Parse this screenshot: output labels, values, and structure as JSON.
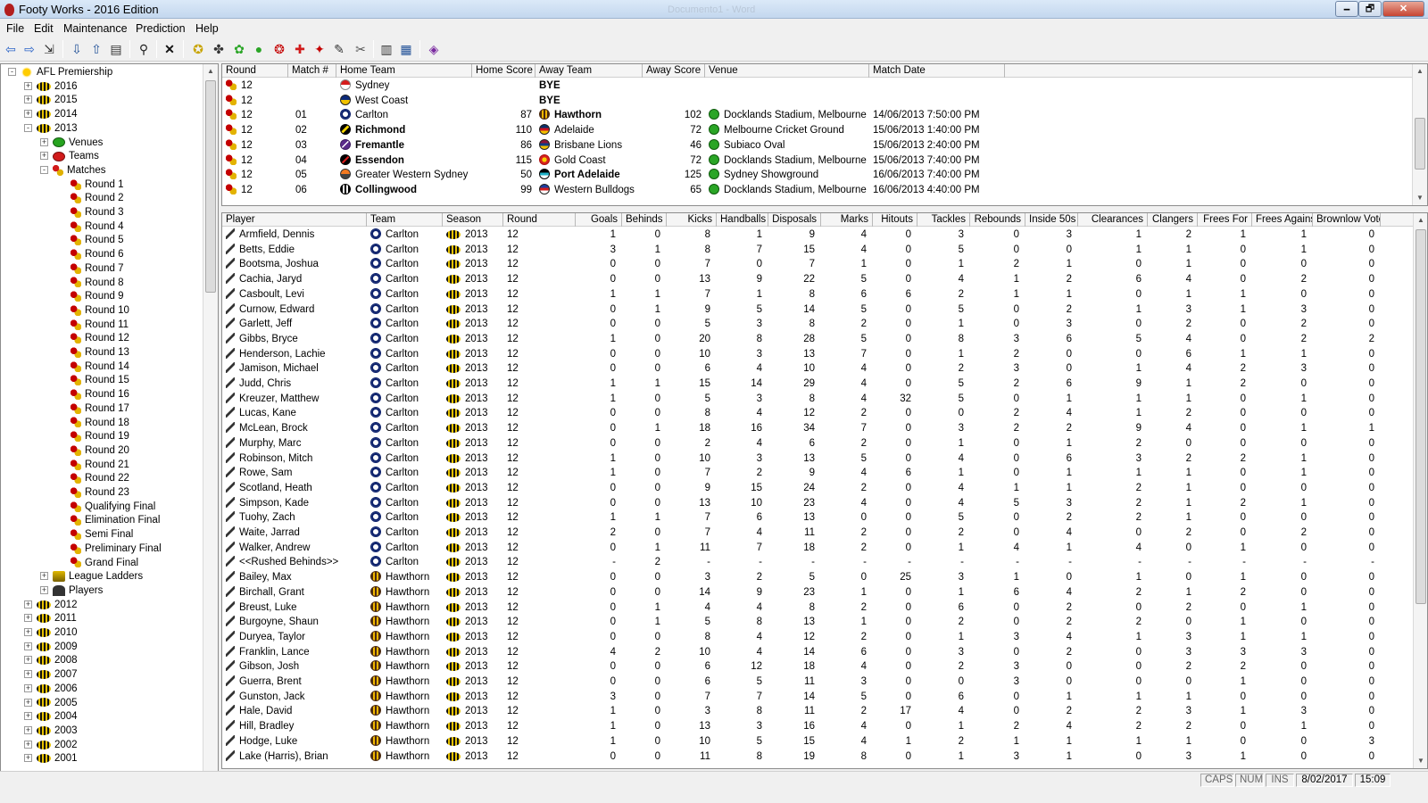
{
  "window": {
    "title": "Footy Works - 2016 Edition",
    "ghost_title": "Documento1 - Word",
    "min_glyph": "🗕",
    "max_glyph": "🗗",
    "close_glyph": "✕"
  },
  "menu": [
    "File",
    "Edit",
    "Maintenance",
    "Prediction",
    "Help"
  ],
  "toolbar_icons": [
    "back-arrow-icon",
    "forward-arrow-icon",
    "go-to-icon",
    "import-icon",
    "export-icon",
    "print-icon",
    "find-icon",
    "delete-icon",
    "add-year-icon",
    "add-round-icon",
    "add-team-icon",
    "add-venue-icon",
    "add-match-icon",
    "add-player-icon",
    "add-stats-icon",
    "add-ladder-icon",
    "tools-icon",
    "book-icon",
    "notes-icon",
    "about-icon"
  ],
  "tree": {
    "root": "AFL Premiership",
    "years_top": [
      "2016",
      "2015",
      "2014"
    ],
    "expanded_year": "2013",
    "year_children": [
      "Venues",
      "Teams",
      "Matches"
    ],
    "rounds": [
      "Round 1",
      "Round 2",
      "Round 3",
      "Round 4",
      "Round 5",
      "Round 6",
      "Round 7",
      "Round 8",
      "Round 9",
      "Round 10",
      "Round 11",
      "Round 12",
      "Round 13",
      "Round 14",
      "Round 15",
      "Round 16",
      "Round 17",
      "Round 18",
      "Round 19",
      "Round 20",
      "Round 21",
      "Round 22",
      "Round 23",
      "Qualifying Final",
      "Elimination Final",
      "Semi Final",
      "Preliminary Final",
      "Grand Final"
    ],
    "after_matches": [
      "League Ladders",
      "Players"
    ],
    "years_bottom": [
      "2012",
      "2011",
      "2010",
      "2009",
      "2008",
      "2007",
      "2006",
      "2005",
      "2004",
      "2003",
      "2002",
      "2001"
    ]
  },
  "matches": {
    "columns": [
      "Round",
      "Match #",
      "Home Team",
      "Home Score",
      "Away Team",
      "Away Score",
      "Venue",
      "Match Date"
    ],
    "rows": [
      {
        "round": "12",
        "match": "",
        "home": "Sydney",
        "home_logo": "t-sydney",
        "home_bold": false,
        "home_score": "",
        "away": "BYE",
        "away_logo": "",
        "away_bold": true,
        "away_score": "",
        "venue": "",
        "date": ""
      },
      {
        "round": "12",
        "match": "",
        "home": "West Coast",
        "home_logo": "t-westcoast",
        "home_bold": false,
        "home_score": "",
        "away": "BYE",
        "away_logo": "",
        "away_bold": true,
        "away_score": "",
        "venue": "",
        "date": ""
      },
      {
        "round": "12",
        "match": "01",
        "home": "Carlton",
        "home_logo": "t-carlton",
        "home_bold": false,
        "home_score": "87",
        "away": "Hawthorn",
        "away_logo": "t-hawthorn",
        "away_bold": true,
        "away_score": "102",
        "venue": "Docklands Stadium, Melbourne",
        "date": "14/06/2013 7:50:00 PM"
      },
      {
        "round": "12",
        "match": "02",
        "home": "Richmond",
        "home_logo": "t-richmond",
        "home_bold": true,
        "home_score": "110",
        "away": "Adelaide",
        "away_logo": "t-adelaide",
        "away_bold": false,
        "away_score": "72",
        "venue": "Melbourne Cricket Ground",
        "date": "15/06/2013 1:40:00 PM"
      },
      {
        "round": "12",
        "match": "03",
        "home": "Fremantle",
        "home_logo": "t-fremantle",
        "home_bold": true,
        "home_score": "86",
        "away": "Brisbane Lions",
        "away_logo": "t-brisbane",
        "away_bold": false,
        "away_score": "46",
        "venue": "Subiaco Oval",
        "date": "15/06/2013 2:40:00 PM"
      },
      {
        "round": "12",
        "match": "04",
        "home": "Essendon",
        "home_logo": "t-essendon",
        "home_bold": true,
        "home_score": "115",
        "away": "Gold Coast",
        "away_logo": "t-goldcoast",
        "away_bold": false,
        "away_score": "72",
        "venue": "Docklands Stadium, Melbourne",
        "date": "15/06/2013 7:40:00 PM"
      },
      {
        "round": "12",
        "match": "05",
        "home": "Greater Western Sydney",
        "home_logo": "t-gws",
        "home_bold": false,
        "home_score": "50",
        "away": "Port Adelaide",
        "away_logo": "t-portadelaide",
        "away_bold": true,
        "away_score": "125",
        "venue": "Sydney Showground",
        "date": "16/06/2013 7:40:00 PM"
      },
      {
        "round": "12",
        "match": "06",
        "home": "Collingwood",
        "home_logo": "t-collingwood",
        "home_bold": true,
        "home_score": "99",
        "away": "Western Bulldogs",
        "away_logo": "t-bulldogs",
        "away_bold": false,
        "away_score": "65",
        "venue": "Docklands Stadium, Melbourne",
        "date": "16/06/2013 4:40:00 PM"
      }
    ]
  },
  "stats": {
    "columns": [
      "Player",
      "Team",
      "Season",
      "Round",
      "Goals",
      "Behinds",
      "Kicks",
      "Handballs",
      "Disposals",
      "Marks",
      "Hitouts",
      "Tackles",
      "Rebounds",
      "Inside 50s",
      "Clearances",
      "Clangers",
      "Frees For",
      "Frees Against",
      "Brownlow Votes"
    ],
    "rows": [
      [
        "Armfield, Dennis",
        "Carlton",
        "2013",
        "12",
        "1",
        "0",
        "8",
        "1",
        "9",
        "4",
        "0",
        "3",
        "0",
        "3",
        "1",
        "2",
        "1",
        "1",
        "0"
      ],
      [
        "Betts, Eddie",
        "Carlton",
        "2013",
        "12",
        "3",
        "1",
        "8",
        "7",
        "15",
        "4",
        "0",
        "5",
        "0",
        "0",
        "1",
        "1",
        "0",
        "1",
        "0"
      ],
      [
        "Bootsma, Joshua",
        "Carlton",
        "2013",
        "12",
        "0",
        "0",
        "7",
        "0",
        "7",
        "1",
        "0",
        "1",
        "2",
        "1",
        "0",
        "1",
        "0",
        "0",
        "0"
      ],
      [
        "Cachia, Jaryd",
        "Carlton",
        "2013",
        "12",
        "0",
        "0",
        "13",
        "9",
        "22",
        "5",
        "0",
        "4",
        "1",
        "2",
        "6",
        "4",
        "0",
        "2",
        "0"
      ],
      [
        "Casboult, Levi",
        "Carlton",
        "2013",
        "12",
        "1",
        "1",
        "7",
        "1",
        "8",
        "6",
        "6",
        "2",
        "1",
        "1",
        "0",
        "1",
        "1",
        "0",
        "0"
      ],
      [
        "Curnow, Edward",
        "Carlton",
        "2013",
        "12",
        "0",
        "1",
        "9",
        "5",
        "14",
        "5",
        "0",
        "5",
        "0",
        "2",
        "1",
        "3",
        "1",
        "3",
        "0"
      ],
      [
        "Garlett, Jeff",
        "Carlton",
        "2013",
        "12",
        "0",
        "0",
        "5",
        "3",
        "8",
        "2",
        "0",
        "1",
        "0",
        "3",
        "0",
        "2",
        "0",
        "2",
        "0"
      ],
      [
        "Gibbs, Bryce",
        "Carlton",
        "2013",
        "12",
        "1",
        "0",
        "20",
        "8",
        "28",
        "5",
        "0",
        "8",
        "3",
        "6",
        "5",
        "4",
        "0",
        "2",
        "2"
      ],
      [
        "Henderson, Lachie",
        "Carlton",
        "2013",
        "12",
        "0",
        "0",
        "10",
        "3",
        "13",
        "7",
        "0",
        "1",
        "2",
        "0",
        "0",
        "6",
        "1",
        "1",
        "0"
      ],
      [
        "Jamison, Michael",
        "Carlton",
        "2013",
        "12",
        "0",
        "0",
        "6",
        "4",
        "10",
        "4",
        "0",
        "2",
        "3",
        "0",
        "1",
        "4",
        "2",
        "3",
        "0"
      ],
      [
        "Judd, Chris",
        "Carlton",
        "2013",
        "12",
        "1",
        "1",
        "15",
        "14",
        "29",
        "4",
        "0",
        "5",
        "2",
        "6",
        "9",
        "1",
        "2",
        "0",
        "0"
      ],
      [
        "Kreuzer, Matthew",
        "Carlton",
        "2013",
        "12",
        "1",
        "0",
        "5",
        "3",
        "8",
        "4",
        "32",
        "5",
        "0",
        "1",
        "1",
        "1",
        "0",
        "1",
        "0"
      ],
      [
        "Lucas, Kane",
        "Carlton",
        "2013",
        "12",
        "0",
        "0",
        "8",
        "4",
        "12",
        "2",
        "0",
        "0",
        "2",
        "4",
        "1",
        "2",
        "0",
        "0",
        "0"
      ],
      [
        "McLean, Brock",
        "Carlton",
        "2013",
        "12",
        "0",
        "1",
        "18",
        "16",
        "34",
        "7",
        "0",
        "3",
        "2",
        "2",
        "9",
        "4",
        "0",
        "1",
        "1"
      ],
      [
        "Murphy, Marc",
        "Carlton",
        "2013",
        "12",
        "0",
        "0",
        "2",
        "4",
        "6",
        "2",
        "0",
        "1",
        "0",
        "1",
        "2",
        "0",
        "0",
        "0",
        "0"
      ],
      [
        "Robinson, Mitch",
        "Carlton",
        "2013",
        "12",
        "1",
        "0",
        "10",
        "3",
        "13",
        "5",
        "0",
        "4",
        "0",
        "6",
        "3",
        "2",
        "2",
        "1",
        "0"
      ],
      [
        "Rowe, Sam",
        "Carlton",
        "2013",
        "12",
        "1",
        "0",
        "7",
        "2",
        "9",
        "4",
        "6",
        "1",
        "0",
        "1",
        "1",
        "1",
        "0",
        "1",
        "0"
      ],
      [
        "Scotland, Heath",
        "Carlton",
        "2013",
        "12",
        "0",
        "0",
        "9",
        "15",
        "24",
        "2",
        "0",
        "4",
        "1",
        "1",
        "2",
        "1",
        "0",
        "0",
        "0"
      ],
      [
        "Simpson, Kade",
        "Carlton",
        "2013",
        "12",
        "0",
        "0",
        "13",
        "10",
        "23",
        "4",
        "0",
        "4",
        "5",
        "3",
        "2",
        "1",
        "2",
        "1",
        "0"
      ],
      [
        "Tuohy, Zach",
        "Carlton",
        "2013",
        "12",
        "1",
        "1",
        "7",
        "6",
        "13",
        "0",
        "0",
        "5",
        "0",
        "2",
        "2",
        "1",
        "0",
        "0",
        "0"
      ],
      [
        "Waite, Jarrad",
        "Carlton",
        "2013",
        "12",
        "2",
        "0",
        "7",
        "4",
        "11",
        "2",
        "0",
        "2",
        "0",
        "4",
        "0",
        "2",
        "0",
        "2",
        "0"
      ],
      [
        "Walker, Andrew",
        "Carlton",
        "2013",
        "12",
        "0",
        "1",
        "11",
        "7",
        "18",
        "2",
        "0",
        "1",
        "4",
        "1",
        "4",
        "0",
        "1",
        "0",
        "0"
      ],
      [
        "<<Rushed Behinds>>",
        "Carlton",
        "2013",
        "12",
        "-",
        "2",
        "-",
        "-",
        "-",
        "-",
        "-",
        "-",
        "-",
        "-",
        "-",
        "-",
        "-",
        "-",
        "-"
      ],
      [
        "Bailey, Max",
        "Hawthorn",
        "2013",
        "12",
        "0",
        "0",
        "3",
        "2",
        "5",
        "0",
        "25",
        "3",
        "1",
        "0",
        "1",
        "0",
        "1",
        "0",
        "0"
      ],
      [
        "Birchall, Grant",
        "Hawthorn",
        "2013",
        "12",
        "0",
        "0",
        "14",
        "9",
        "23",
        "1",
        "0",
        "1",
        "6",
        "4",
        "2",
        "1",
        "2",
        "0",
        "0"
      ],
      [
        "Breust, Luke",
        "Hawthorn",
        "2013",
        "12",
        "0",
        "1",
        "4",
        "4",
        "8",
        "2",
        "0",
        "6",
        "0",
        "2",
        "0",
        "2",
        "0",
        "1",
        "0"
      ],
      [
        "Burgoyne, Shaun",
        "Hawthorn",
        "2013",
        "12",
        "0",
        "1",
        "5",
        "8",
        "13",
        "1",
        "0",
        "2",
        "0",
        "2",
        "2",
        "0",
        "1",
        "0",
        "0"
      ],
      [
        "Duryea, Taylor",
        "Hawthorn",
        "2013",
        "12",
        "0",
        "0",
        "8",
        "4",
        "12",
        "2",
        "0",
        "1",
        "3",
        "4",
        "1",
        "3",
        "1",
        "1",
        "0"
      ],
      [
        "Franklin, Lance",
        "Hawthorn",
        "2013",
        "12",
        "4",
        "2",
        "10",
        "4",
        "14",
        "6",
        "0",
        "3",
        "0",
        "2",
        "0",
        "3",
        "3",
        "3",
        "0"
      ],
      [
        "Gibson, Josh",
        "Hawthorn",
        "2013",
        "12",
        "0",
        "0",
        "6",
        "12",
        "18",
        "4",
        "0",
        "2",
        "3",
        "0",
        "0",
        "2",
        "2",
        "0",
        "0"
      ],
      [
        "Guerra, Brent",
        "Hawthorn",
        "2013",
        "12",
        "0",
        "0",
        "6",
        "5",
        "11",
        "3",
        "0",
        "0",
        "3",
        "0",
        "0",
        "0",
        "1",
        "0",
        "0"
      ],
      [
        "Gunston, Jack",
        "Hawthorn",
        "2013",
        "12",
        "3",
        "0",
        "7",
        "7",
        "14",
        "5",
        "0",
        "6",
        "0",
        "1",
        "1",
        "1",
        "0",
        "0",
        "0"
      ],
      [
        "Hale, David",
        "Hawthorn",
        "2013",
        "12",
        "1",
        "0",
        "3",
        "8",
        "11",
        "2",
        "17",
        "4",
        "0",
        "2",
        "2",
        "3",
        "1",
        "3",
        "0"
      ],
      [
        "Hill, Bradley",
        "Hawthorn",
        "2013",
        "12",
        "1",
        "0",
        "13",
        "3",
        "16",
        "4",
        "0",
        "1",
        "2",
        "4",
        "2",
        "2",
        "0",
        "1",
        "0"
      ],
      [
        "Hodge, Luke",
        "Hawthorn",
        "2013",
        "12",
        "1",
        "0",
        "10",
        "5",
        "15",
        "4",
        "1",
        "2",
        "1",
        "1",
        "1",
        "1",
        "0",
        "0",
        "3"
      ],
      [
        "Lake (Harris), Brian",
        "Hawthorn",
        "2013",
        "12",
        "0",
        "0",
        "11",
        "8",
        "19",
        "8",
        "0",
        "1",
        "3",
        "1",
        "0",
        "3",
        "1",
        "0",
        "0"
      ]
    ]
  },
  "status": {
    "caps": "CAPS",
    "num": "NUM",
    "ins": "INS",
    "date": "8/02/2017",
    "time": "15:09"
  }
}
